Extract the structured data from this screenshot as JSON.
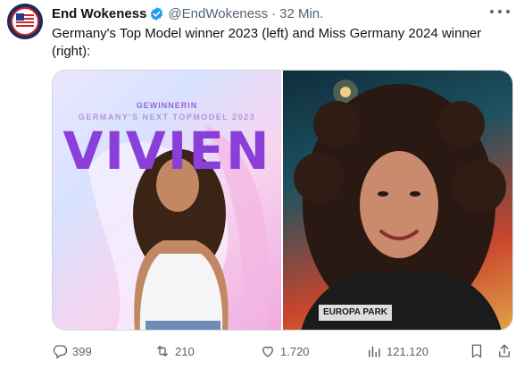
{
  "tweet": {
    "author_name": "End Wokeness",
    "handle": "@EndWokeness",
    "separator": "·",
    "time": "32 Min.",
    "text": "Germany's Top Model winner 2023 (left) and Miss Germany 2024 winner (right):"
  },
  "media": {
    "left": {
      "tag": "GEWINNERIN",
      "subtitle": "GERMANY'S NEXT TOPMODEL 2023",
      "name": "VIVIEN"
    },
    "right": {
      "shirt_text": "EUROPA PARK"
    }
  },
  "actions": {
    "replies": "399",
    "retweets": "210",
    "likes": "1.720",
    "views": "121.120"
  },
  "colors": {
    "accent": "#1d9bf0",
    "muted": "#536471",
    "vivien_purple": "#8a3fd9"
  },
  "icons": [
    "verified-badge-icon",
    "more-icon",
    "reply-icon",
    "retweet-icon",
    "like-icon",
    "views-icon",
    "bookmark-icon",
    "share-icon"
  ]
}
